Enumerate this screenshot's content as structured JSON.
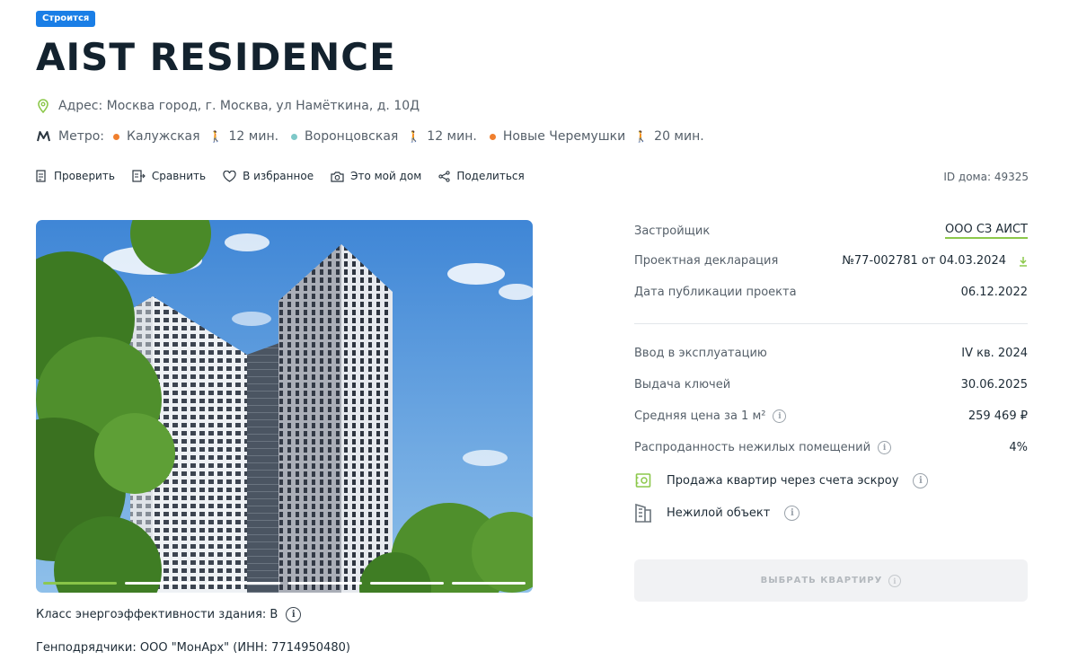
{
  "status_badge": "Строится",
  "title": "AIST RESIDENCE",
  "address": {
    "text": "Адрес: Москва город, г. Москва, ул Намёткина, д. 10Д"
  },
  "metro": {
    "label": "Метро:",
    "stations": [
      {
        "name": "Калужская",
        "time": "12 мин.",
        "color": "#f07f2e"
      },
      {
        "name": "Воронцовская",
        "time": "12 мин.",
        "color": "#7ec8c8"
      },
      {
        "name": "Новые Черемушки",
        "time": "20 мин.",
        "color": "#f07f2e"
      }
    ]
  },
  "actions": {
    "check": "Проверить",
    "compare": "Сравнить",
    "favorite": "В избранное",
    "my_home": "Это мой дом",
    "share": "Поделиться"
  },
  "house_id": "ID дома: 49325",
  "gallery": {
    "slides": 6,
    "active_index": 0
  },
  "specs": [
    {
      "label": "Застройщик",
      "value": "ООО СЗ АИСТ"
    },
    {
      "label": "Проектная декларация",
      "value": "№77-002781 от 04.03.2024"
    },
    {
      "label": "Дата публикации проекта",
      "value": "06.12.2022"
    },
    {
      "label": "Ввод в эксплуатацию",
      "value": "IV кв. 2024"
    },
    {
      "label": "Выдача ключей",
      "value": "30.06.2025"
    },
    {
      "label": "Средняя цена за 1 м²",
      "value": "259 469 ₽"
    },
    {
      "label": "Распроданность нежилых помещений",
      "value": "4%"
    }
  ],
  "features": {
    "escrow": "Продажа квартир через счета эскроу",
    "nonresidential": "Нежилой объект"
  },
  "cta_label": "ВЫБРАТЬ КВАРТИРУ",
  "energy_class": "Класс энергоэффективности здания: B",
  "general_contractor": "Генподрядчики: ООО \"МонАрх\" (ИНН: 7714950480)",
  "colors": {
    "accent_green": "#8cc84b",
    "badge_blue": "#1a7ee6",
    "text_dark": "#13222e"
  }
}
